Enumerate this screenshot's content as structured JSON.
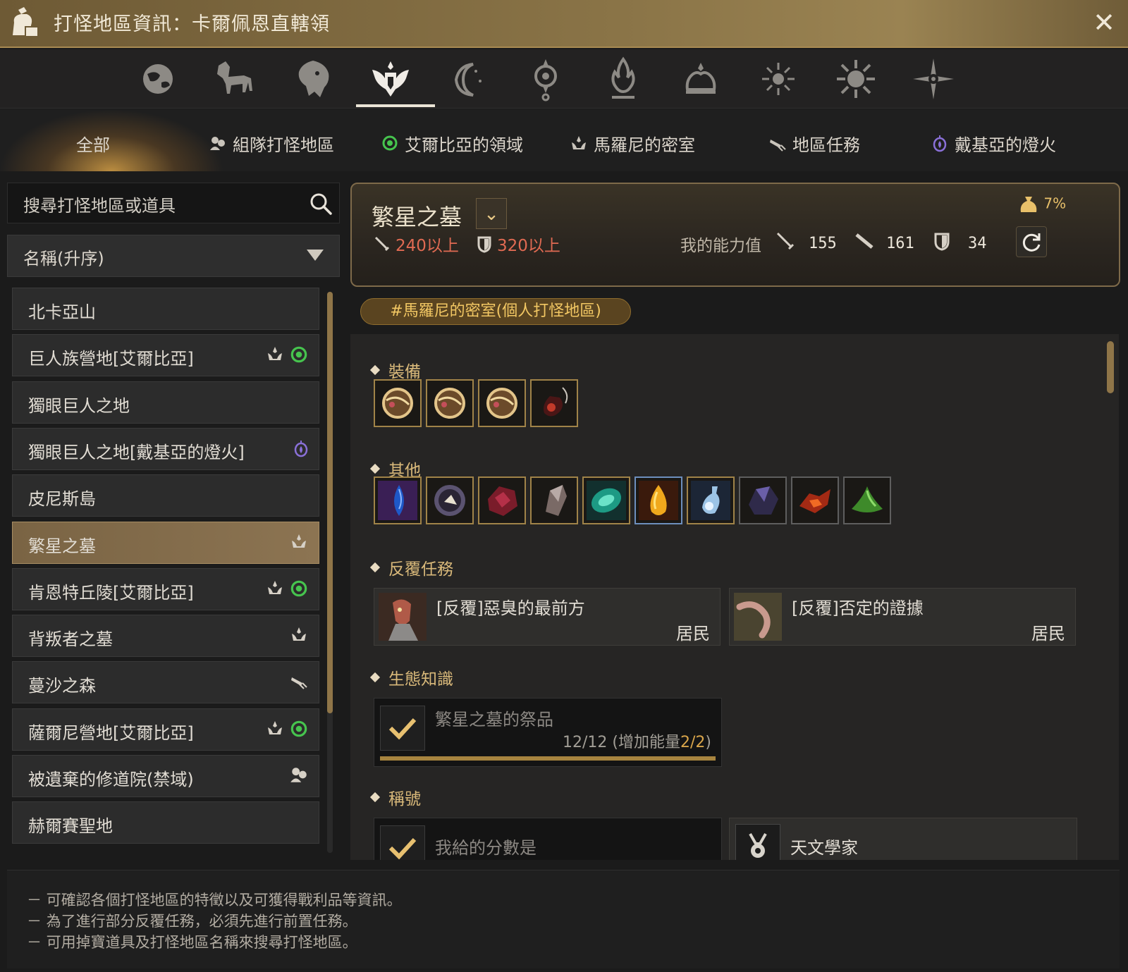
{
  "window": {
    "title": "打怪地區資訊：卡爾佩恩直轄領",
    "close_icon": "close-icon"
  },
  "region_icons": [
    "globe-icon",
    "horse-icon",
    "lion-icon",
    "winged-crest-icon",
    "moon-icon",
    "compass-icon",
    "tree-flame-icon",
    "crown-icon",
    "sun-small-icon",
    "sun-large-icon",
    "star-icon"
  ],
  "tabs": [
    {
      "label": "全部"
    },
    {
      "label": "組隊打怪地區",
      "icon": "party-icon"
    },
    {
      "label": "艾爾比亞的領域",
      "icon": "elvia-icon"
    },
    {
      "label": "馬羅尼的密室",
      "icon": "marni-icon"
    },
    {
      "label": "地區任務",
      "icon": "telescope-icon"
    },
    {
      "label": "戴基亞的燈火",
      "icon": "lantern-icon"
    }
  ],
  "search": {
    "placeholder": "搜尋打怪地區或道具"
  },
  "sort": {
    "value": "名稱(升序)"
  },
  "zones": [
    {
      "name": "北卡亞山",
      "badges": []
    },
    {
      "name": "巨人族營地[艾爾比亞]",
      "badges": [
        "marni",
        "elvia"
      ]
    },
    {
      "name": "獨眼巨人之地",
      "badges": []
    },
    {
      "name": "獨眼巨人之地[戴基亞的燈火]",
      "badges": [
        "lantern"
      ]
    },
    {
      "name": "皮尼斯島",
      "badges": []
    },
    {
      "name": "繁星之墓",
      "badges": [
        "marni"
      ],
      "selected": true
    },
    {
      "name": "肯恩特丘陵[艾爾比亞]",
      "badges": [
        "marni",
        "elvia"
      ]
    },
    {
      "name": "背叛者之墓",
      "badges": [
        "marni"
      ]
    },
    {
      "name": "蔓沙之森",
      "badges": [
        "telescope"
      ]
    },
    {
      "name": "薩爾尼營地[艾爾比亞]",
      "badges": [
        "marni",
        "elvia"
      ]
    },
    {
      "name": "被遺棄的修道院(禁域)",
      "badges": [
        "party"
      ]
    },
    {
      "name": "赫爾賽聖地",
      "badges": []
    }
  ],
  "detail": {
    "zone_name": "繁星之墓",
    "req_ap": "240以上",
    "req_dp": "320以上",
    "my_stats_label": "我的能力值",
    "my_ap": "155",
    "my_aap": "161",
    "my_dp": "34",
    "drop_bonus": "7%",
    "tag": "#馬羅尼的密室(個人打怪地區)"
  },
  "sections": {
    "equipment": "裝備",
    "other": "其他",
    "repeat_quests": "反覆任務",
    "knowledge": "生態知識",
    "titles": "稱號"
  },
  "equipment_items": [
    "ring-icon",
    "ring-icon",
    "ring-icon",
    "necklace-icon"
  ],
  "other_items": [
    "blue-gem-icon",
    "purple-orb-icon",
    "red-ore-icon",
    "crystal-icon",
    "green-jewel-icon",
    "golden-drop-icon",
    "potion-icon",
    "dark-ore-icon",
    "fire-fragment-icon",
    "green-mound-icon"
  ],
  "quests": [
    {
      "title": "[反覆]惡臭的最前方",
      "giver": "居民"
    },
    {
      "title": "[反覆]否定的證據",
      "giver": "居民"
    }
  ],
  "knowledge": {
    "title": "繁星之墓的祭品",
    "progress": "12/12 (增加能量",
    "energy": "2/2",
    "close": ")"
  },
  "titles": [
    {
      "label": "我給的分數是"
    },
    {
      "label": "天文學家"
    }
  ],
  "notes": [
    "－ 可確認各個打怪地區的特徵以及可獲得戰利品等資訊。",
    "－ 為了進行部分反覆任務，必須先進行前置任務。",
    "－ 可用掉寶道具及打怪地區名稱來搜尋打怪地區。"
  ],
  "colors": {
    "accent": "#d9b97a",
    "selected": "#8c7452",
    "warning": "#e06a52",
    "elvia": "#46c44e",
    "lantern": "#8a70d8"
  }
}
